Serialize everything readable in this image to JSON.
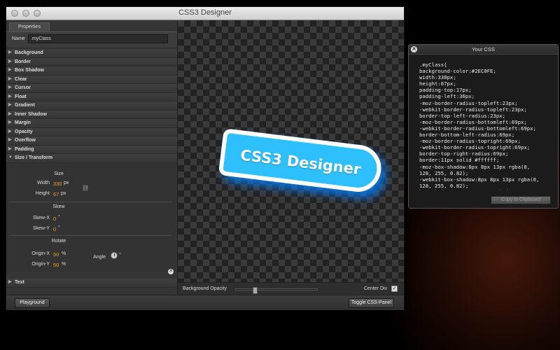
{
  "window": {
    "title": "CSS3 Designer"
  },
  "properties_tab": {
    "label": "Properties"
  },
  "name_field": {
    "label": "Name",
    "value": ".myClass"
  },
  "property_groups": [
    {
      "label": "Background",
      "expanded": false
    },
    {
      "label": "Border",
      "expanded": false
    },
    {
      "label": "Box Shadow",
      "expanded": false
    },
    {
      "label": "Clear",
      "expanded": false
    },
    {
      "label": "Cursor",
      "expanded": false
    },
    {
      "label": "Float",
      "expanded": false
    },
    {
      "label": "Gradient",
      "expanded": false
    },
    {
      "label": "Inner Shadow",
      "expanded": false
    },
    {
      "label": "Margin",
      "expanded": false
    },
    {
      "label": "Opacity",
      "expanded": false
    },
    {
      "label": "Overflow",
      "expanded": false
    },
    {
      "label": "Padding",
      "expanded": false
    },
    {
      "label": "Size / Transform",
      "expanded": true
    }
  ],
  "size_transform": {
    "size": {
      "title": "Size",
      "width_label": "Width",
      "width_value": "330",
      "width_unit": "px",
      "height_label": "Height",
      "height_value": "67",
      "height_unit": "px"
    },
    "skew": {
      "title": "Skew",
      "x_label": "Skew-X",
      "x_value": "0",
      "x_unit": "°",
      "y_label": "Skew-Y",
      "y_value": "0",
      "y_unit": "°"
    },
    "rotate": {
      "title": "Rotate",
      "origin_x_label": "Origin-X",
      "origin_x_value": "50",
      "origin_x_unit": "%",
      "origin_y_label": "Origin-Y",
      "origin_y_value": "50",
      "origin_y_unit": "%",
      "angle_label": "Angle",
      "angle_unit": "°"
    }
  },
  "text_group": {
    "label": "Text"
  },
  "preview": {
    "text": "CSS3 Designer",
    "background": "#2EC0FE",
    "border_color": "#ffffff"
  },
  "canvas_footer": {
    "opacity_label": "Background Opacity",
    "opacity_value": 0.22,
    "center_div_label": "Center Div",
    "center_div_checked": "✓"
  },
  "bottom_bar": {
    "playground_label": "Playground",
    "toggle_label": "Toggle CSS-Panel"
  },
  "css_panel": {
    "title": "Your CSS",
    "code": ".myClass{\nbackground-color:#2EC0FE;\nwidth:330px;\nheight:67px;\npadding-top:17px;\npadding-left:36px;\n-moz-border-radius-topleft:23px;\n-webkit-border-radius-topleft:23px;\nborder-top-left-radius:23px;\n-moz-border-radius-bottomleft:69px;\n-webkit-border-radius-bottomleft:69px;\nborder-bottom-left-radius:69px;\n-moz-border-radius-topright:69px;\n-webkit-border-radius-topright:69px;\nborder-top-right-radius:69px;\nborder:11px solid #ffffff;\n-moz-box-shadow:8px 8px 13px rgba(0,\n128, 255, 0.82);\n-webkit-box-shadow:8px 8px 13px rgba(0,\n128, 255, 0.82);\nbox-shadow:8px 8px 13px rgba(0, 128,",
    "copy_label": "Copy to Clipboard"
  }
}
